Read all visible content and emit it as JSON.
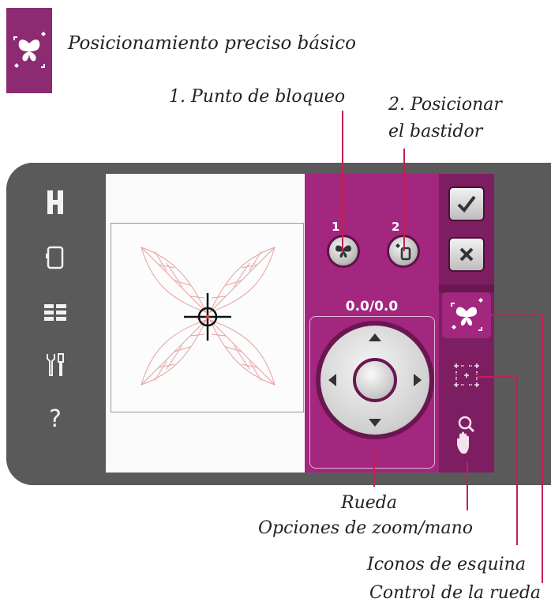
{
  "header": {
    "title": "Posicionamiento preciso básico"
  },
  "callouts": {
    "lock_point": "1. Punto de bloqueo",
    "position_hoop_line1": "2. Posicionar",
    "position_hoop_line2": "el bastidor",
    "wheel": "Rueda",
    "zoom_hand": "Opciones de zoom/mano",
    "corner_icons": "Iconos de esquina",
    "wheel_control": "Control de la rueda"
  },
  "panel": {
    "button1_number": "1",
    "button2_number": "2",
    "coordinates": "0.0/0.0"
  },
  "left_rail": {
    "items": [
      "home-h-icon",
      "hoop-icon",
      "grid-list-icon",
      "tools-icon",
      "help-icon"
    ],
    "help_label": "?"
  },
  "icons": {
    "ok": "checkmark-icon",
    "cancel": "close-icon"
  },
  "colors": {
    "accent": "#a3267f",
    "sidebar": "#7e1e62",
    "device": "#5a5a5a",
    "callout_line": "#c31f55",
    "stitch": "#e7a0a0"
  }
}
